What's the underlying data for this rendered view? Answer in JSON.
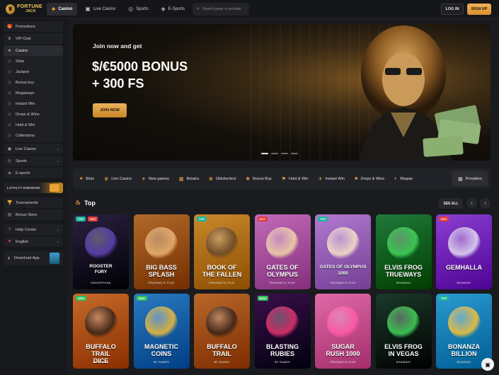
{
  "brand": {
    "line1": "FORTUNE",
    "line2": "JACK"
  },
  "topnav": [
    {
      "label": "Casino",
      "icon": "casino-icon",
      "glyph": "♣",
      "active": true
    },
    {
      "label": "Live Casino",
      "icon": "live-icon",
      "glyph": "▣",
      "active": false
    },
    {
      "label": "Sports",
      "icon": "sports-icon",
      "glyph": "◎",
      "active": false
    },
    {
      "label": "E-Sports",
      "icon": "esports-icon",
      "glyph": "◈",
      "active": false
    }
  ],
  "search": {
    "placeholder": "Search game or provider"
  },
  "auth": {
    "login": "LOG IN",
    "signup": "SIGN UP"
  },
  "sidebar": {
    "promotions": "Promotions",
    "vip": "VIP Club",
    "casino": "Casino",
    "casino_items": [
      "Slots",
      "Jackpot",
      "Bonus buy",
      "Megaways",
      "Instant Win",
      "Drops & Wins",
      "Hold & Win",
      "Collections"
    ],
    "live_casino": "Live Casino",
    "sports": "Sports",
    "esports": "E-sports",
    "loyalty": "LOYALTY KINGDOM",
    "tournaments": "Tournaments",
    "bonus_store": "Bonus Store",
    "help": "Help Center",
    "language": "English",
    "download": "Download App"
  },
  "hero": {
    "subtitle": "Join now and get",
    "title_line1": "$/€5000 BONUS",
    "title_line2": "+ 300 FS",
    "button": "JOIN NOW"
  },
  "categories": [
    {
      "label": "Slots",
      "glyph": "♠"
    },
    {
      "label": "Live Casino",
      "glyph": "♛"
    },
    {
      "label": "New games",
      "glyph": "✦"
    },
    {
      "label": "Belatra",
      "glyph": "▦"
    },
    {
      "label": "Oktoberfest",
      "glyph": "❀"
    },
    {
      "label": "Bonus Buy",
      "glyph": "✚"
    },
    {
      "label": "Hold & Win",
      "glyph": "⚑"
    },
    {
      "label": "Instant Win",
      "glyph": "✈"
    },
    {
      "label": "Drops & Wins",
      "glyph": "♣"
    },
    {
      "label": "Megaw",
      "glyph": "◐"
    }
  ],
  "providers_btn": "Providers",
  "section": {
    "title": "Top",
    "see_all": "SEE ALL"
  },
  "games": [
    {
      "name": "ROOSTER\nFURY",
      "provider": "ENDORPHINA",
      "tags": [
        "TOP",
        "HOT"
      ],
      "bg": "#2a2140",
      "art": "#5a3fb0",
      "small": true
    },
    {
      "name": "BIG BASS\nSPLASH",
      "provider": "PRAGMATIC PLAY",
      "tags": [],
      "bg": "#b06a2a",
      "art": "#e8b070",
      "small": false
    },
    {
      "name": "BOOK OF\nTHE FALLEN",
      "provider": "PRAGMATIC PLAY",
      "tags": [
        "TOP"
      ],
      "bg": "#c9892b",
      "art": "#6a4a2a",
      "small": false
    },
    {
      "name": "GATES OF\nOLYMPUS",
      "provider": "PRAGMATIC PLAY",
      "tags": [
        "HOT"
      ],
      "bg": "#c06ab8",
      "art": "#f0d2a8",
      "small": false
    },
    {
      "name": "GATES OF OLYMPUS\n1000",
      "provider": "PRAGMATIC PLAY",
      "tags": [
        "TOP"
      ],
      "bg": "#b07ad0",
      "art": "#f3e0c8",
      "small": false
    },
    {
      "name": "ELVIS FROG\nTRUEWAYS",
      "provider": "BGAMING",
      "tags": [],
      "bg": "#1f7a3a",
      "art": "#3fcf55",
      "small": false
    },
    {
      "name": "GEMHALLA",
      "provider": "BGAMING",
      "tags": [
        "HOT"
      ],
      "bg": "#8a3fd0",
      "art": "#e0d6f0",
      "small": false
    },
    {
      "name": "BUFFALO\nTRAIL\nDICE",
      "provider": "BF GAMES",
      "tags": [
        "NEW"
      ],
      "bg": "#c66a2a",
      "art": "#3a2418",
      "small": false
    },
    {
      "name": "MAGNETIC\nCOINS",
      "provider": "BF GAMES",
      "tags": [
        "NEW"
      ],
      "bg": "#2a7ac0",
      "art": "#e8b83a",
      "small": false
    },
    {
      "name": "BUFFALO\nTRAIL",
      "provider": "BF GAMES",
      "tags": [],
      "bg": "#b9682a",
      "art": "#3a2418",
      "small": false
    },
    {
      "name": "BLASTING\nRUBIES",
      "provider": "BF GAMES",
      "tags": [
        "NEW"
      ],
      "bg": "#3a0f4a",
      "art": "#e0306a",
      "small": false
    },
    {
      "name": "SUGAR\nRUSH 1000",
      "provider": "PRAGMATIC PLAY",
      "tags": [],
      "bg": "#e06aa8",
      "art": "#ff5aa8",
      "small": false
    },
    {
      "name": "ELVIS FROG\nIN VEGAS",
      "provider": "BGAMING",
      "tags": [],
      "bg": "#1a3a2a",
      "art": "#3fcf55",
      "small": false
    },
    {
      "name": "BONANZA\nBILLION",
      "provider": "BGAMING",
      "tags": [
        "TOP"
      ],
      "bg": "#2a9ad0",
      "art": "#f0c03a",
      "small": false
    }
  ],
  "colors": {
    "accent": "#e8a33a",
    "bg": "#1a1b1f",
    "panel": "#222328"
  }
}
